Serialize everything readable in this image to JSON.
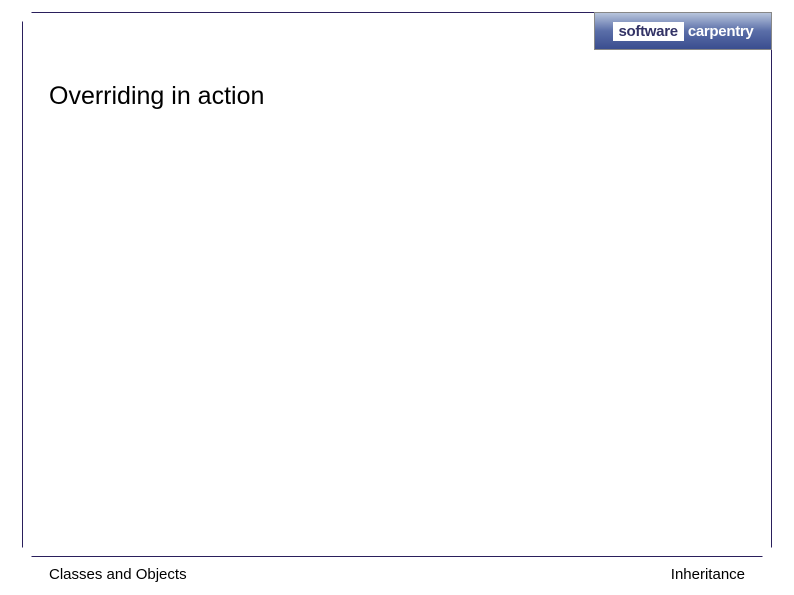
{
  "logo": {
    "word1": "software",
    "word2": "carpentry"
  },
  "slide": {
    "title": "Overriding in action"
  },
  "footer": {
    "left": "Classes and Objects",
    "right": "Inheritance"
  }
}
